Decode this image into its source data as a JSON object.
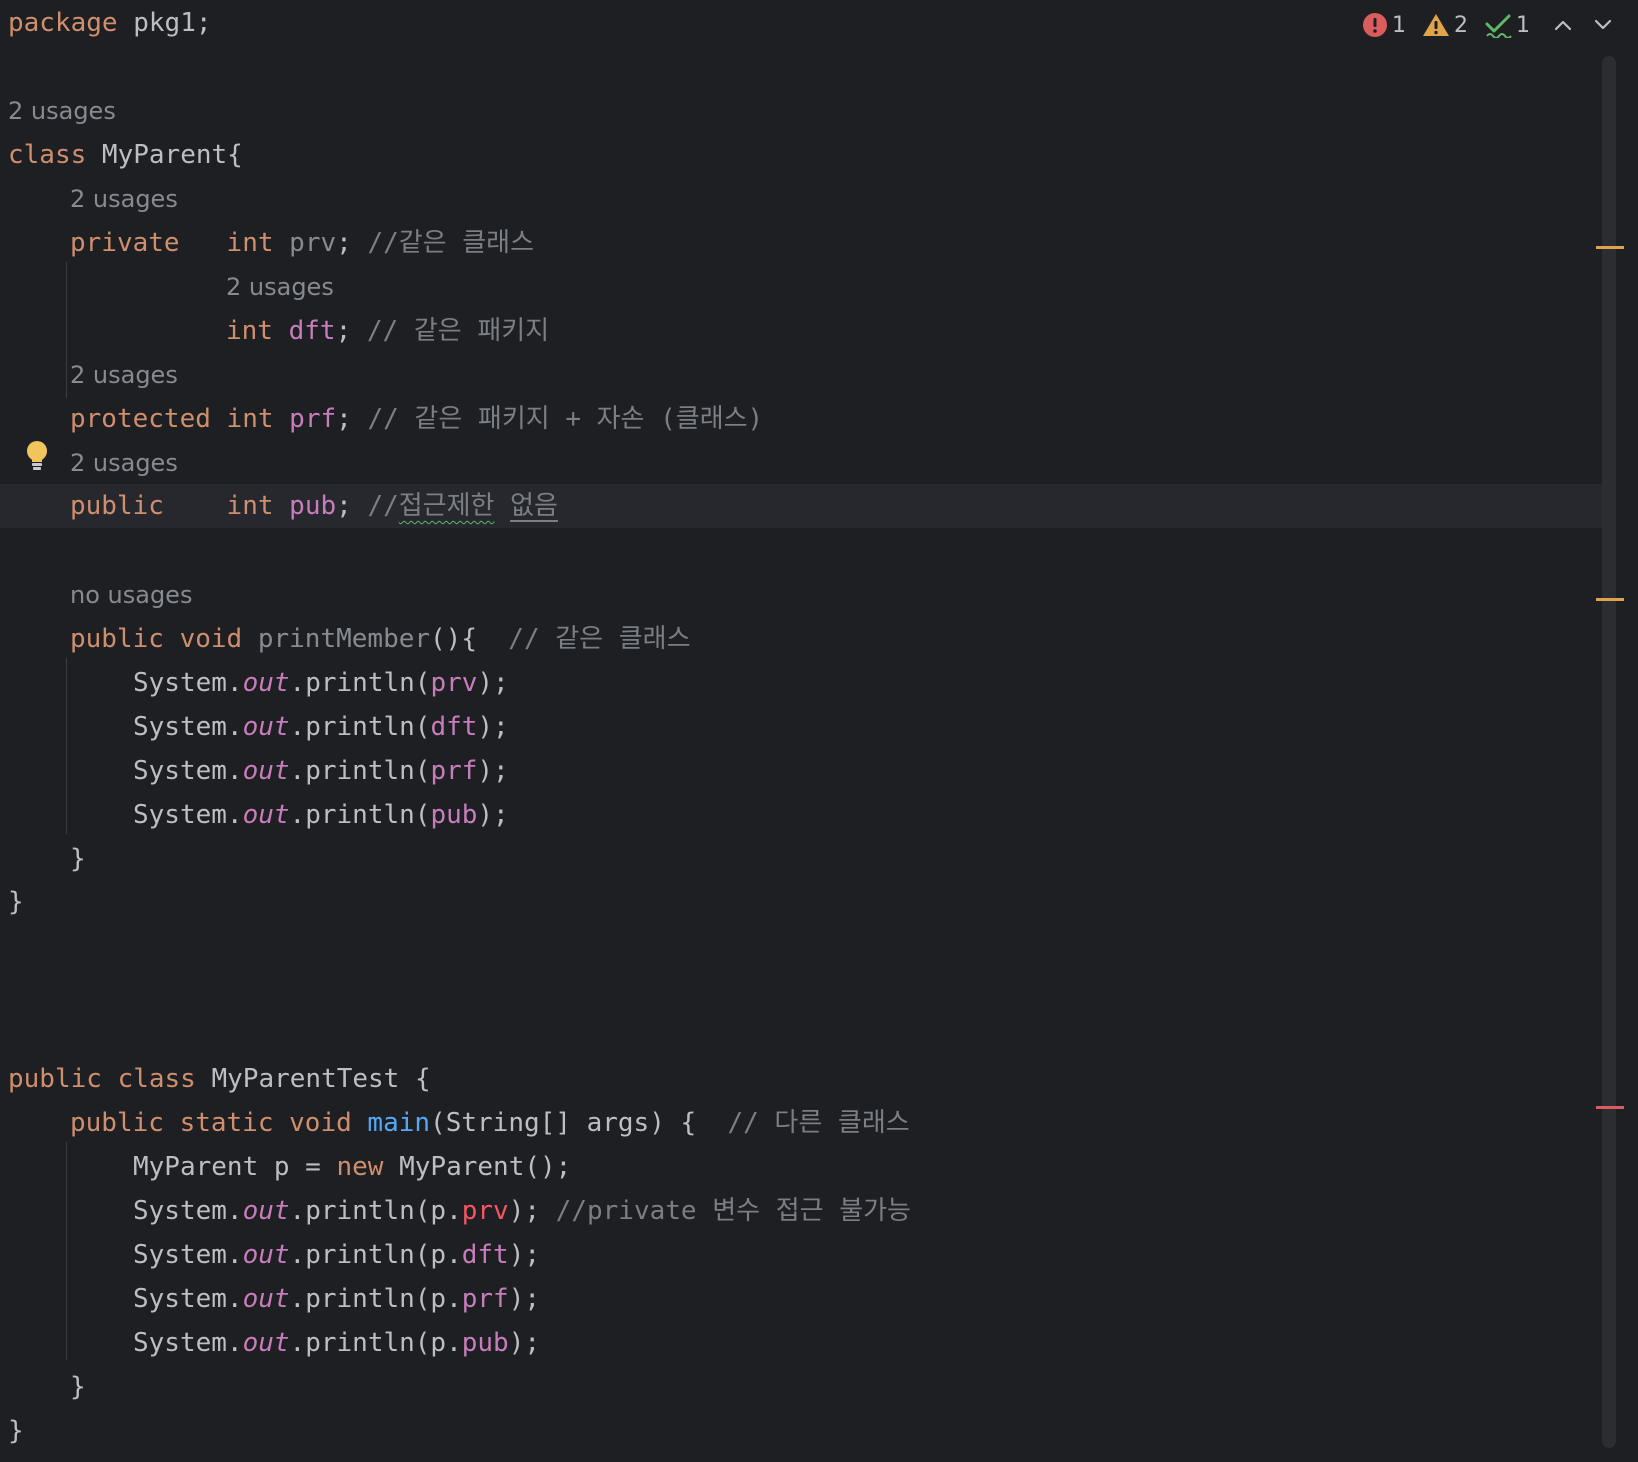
{
  "editor": {
    "inspections": {
      "errors": "1",
      "warnings": "2",
      "typos": "1",
      "error_color": "#db5c5c",
      "warning_color": "#e0a24a",
      "typo_color": "#5fb865"
    },
    "code": {
      "l01": {
        "kw": "package",
        "rest": " pkg1;"
      },
      "h01": "2 usages",
      "l02": {
        "kw": "class",
        "rest": " MyParent{"
      },
      "h02": "2 usages",
      "l03": {
        "kw": "private",
        "sp": "   ",
        "type": "int",
        "sp2": " ",
        "name": "prv",
        "semi": "; ",
        "comment": "//같은 클래스"
      },
      "h03": "2 usages",
      "l04": {
        "type": "int",
        "sp2": " ",
        "name": "dft",
        "semi": "; ",
        "comment": "// 같은 패키지"
      },
      "h04": "2 usages",
      "l05": {
        "kw": "protected",
        "sp": " ",
        "type": "int",
        "sp2": " ",
        "name": "prf",
        "semi": "; ",
        "comment": "// 같은 패키지 + 자손 (클래스)"
      },
      "h05": "2 usages",
      "l06": {
        "kw": "public",
        "sp": "    ",
        "type": "int",
        "sp2": " ",
        "name": "pub",
        "semi": "; ",
        "comment_a": "//",
        "comment_b": "접근제한",
        "comment_c": " ",
        "comment_d": "없음"
      },
      "h06": "no usages",
      "l07": {
        "kw": "public void",
        "sp": " ",
        "name": "printMember",
        "rest": "(){",
        "comment": "  // 같은 클래스"
      },
      "l08": {
        "cls": "System.",
        "st": "out",
        "call": ".println(",
        "arg": "prv",
        "end": ");"
      },
      "l09": {
        "cls": "System.",
        "st": "out",
        "call": ".println(",
        "arg": "dft",
        "end": ");"
      },
      "l10": {
        "cls": "System.",
        "st": "out",
        "call": ".println(",
        "arg": "prf",
        "end": ");"
      },
      "l11": {
        "cls": "System.",
        "st": "out",
        "call": ".println(",
        "arg": "pub",
        "end": ");"
      },
      "l12": "}",
      "l13": "}",
      "l14": {
        "kw": "public class",
        "rest": " MyParentTest {"
      },
      "l15": {
        "kw": "public static void",
        "sp": " ",
        "fn": "main",
        "rest": "(String[] args) {",
        "comment": "  // 다른 클래스"
      },
      "l16": {
        "a": "MyParent p = ",
        "kw": "new",
        "b": " MyParent();"
      },
      "l17": {
        "cls": "System.",
        "st": "out",
        "call": ".println(p.",
        "arg": "prv",
        "end": "); ",
        "comment": "//private 변수 접근 불가능"
      },
      "l18": {
        "cls": "System.",
        "st": "out",
        "call": ".println(p.",
        "arg": "dft",
        "end": ");"
      },
      "l19": {
        "cls": "System.",
        "st": "out",
        "call": ".println(p.",
        "arg": "prf",
        "end": ");"
      },
      "l20": {
        "cls": "System.",
        "st": "out",
        "call": ".println(p.",
        "arg": "pub",
        "end": ");"
      },
      "l21": "}",
      "l22": "}"
    }
  }
}
